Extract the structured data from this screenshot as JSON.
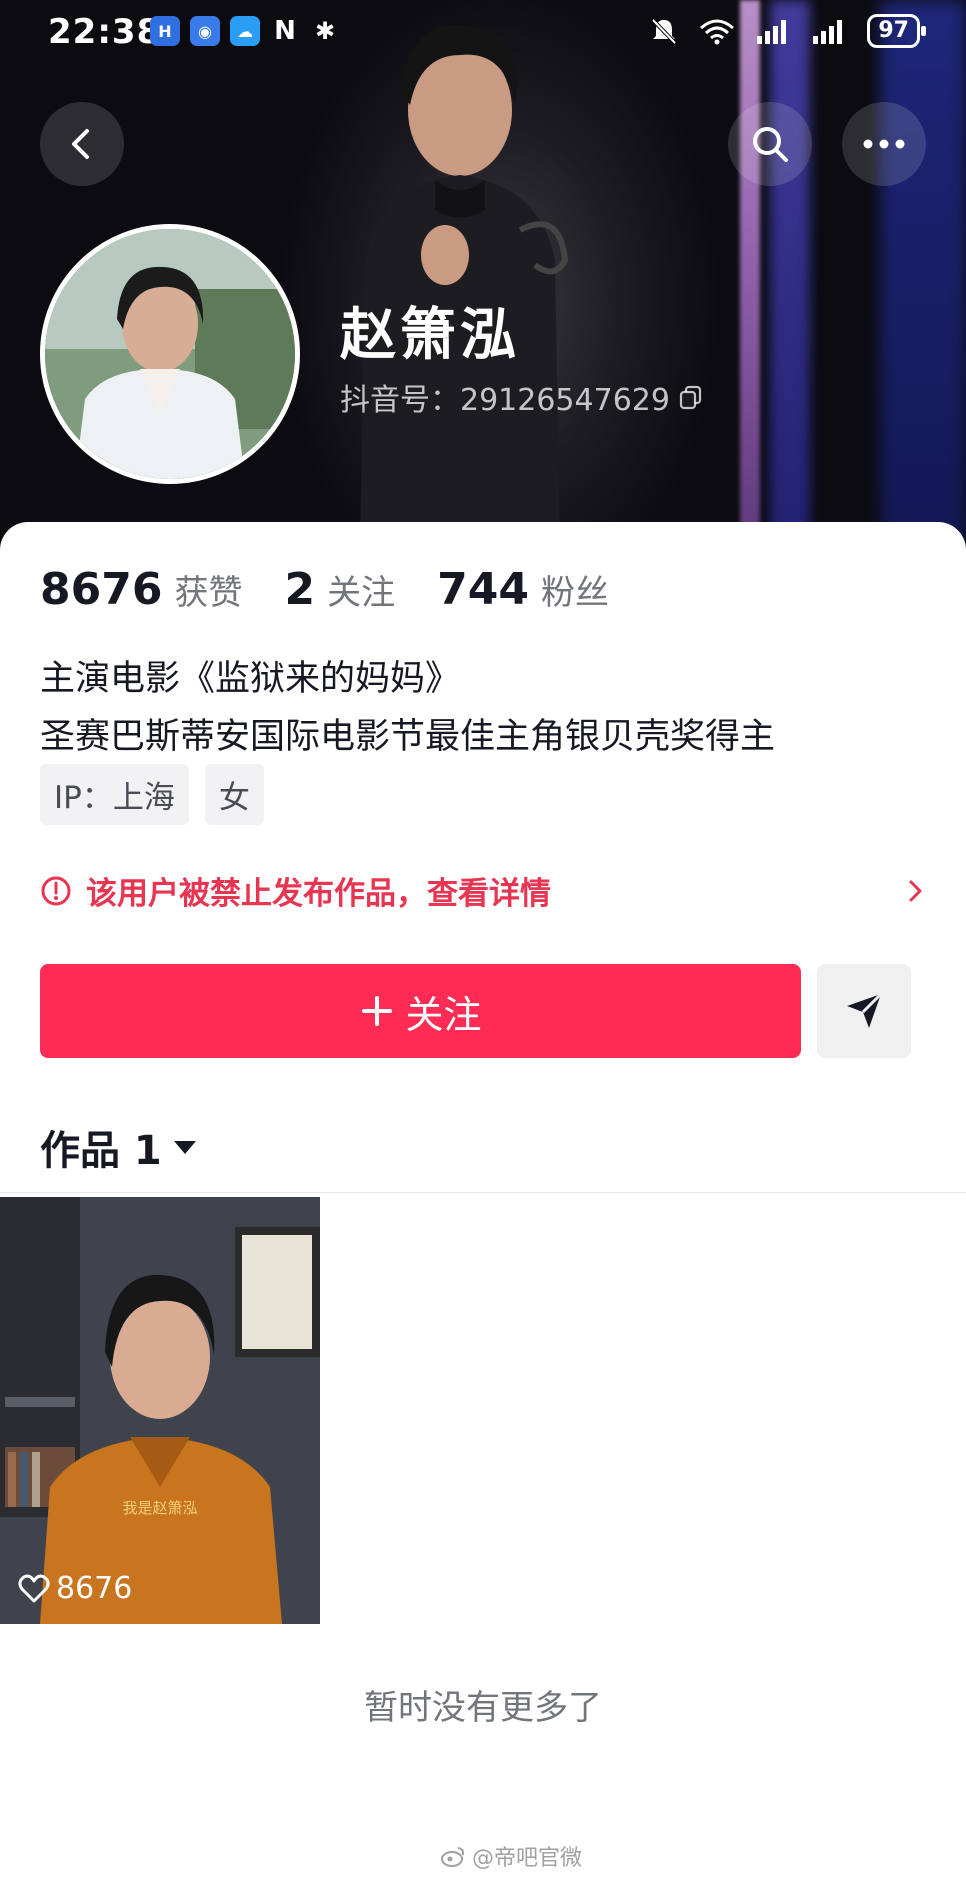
{
  "status_bar": {
    "time": "22:38",
    "battery": "97"
  },
  "profile": {
    "name": "赵箫泓",
    "douyin_id": "抖音号：29126547629"
  },
  "stats": [
    {
      "value": "8676",
      "label": "获赞"
    },
    {
      "value": "2",
      "label": "关注"
    },
    {
      "value": "744",
      "label": "粉丝"
    }
  ],
  "bio": {
    "line1": "主演电影《监狱来的妈妈》",
    "line2": "圣赛巴斯蒂安国际电影节最佳主角银贝壳奖得主"
  },
  "tags": [
    "IP：上海",
    "女"
  ],
  "notice": {
    "text": "该用户被禁止发布作品，查看详情"
  },
  "actions": {
    "follow_label": "关注"
  },
  "works": {
    "header": "作品 1",
    "items": [
      {
        "likes": "8676",
        "caption": "我是赵箫泓"
      }
    ],
    "end_text": "暂时没有更多了"
  },
  "watermark": "@帝吧官微",
  "colors": {
    "accent": "#fe2c55",
    "notice": "#e73552"
  }
}
